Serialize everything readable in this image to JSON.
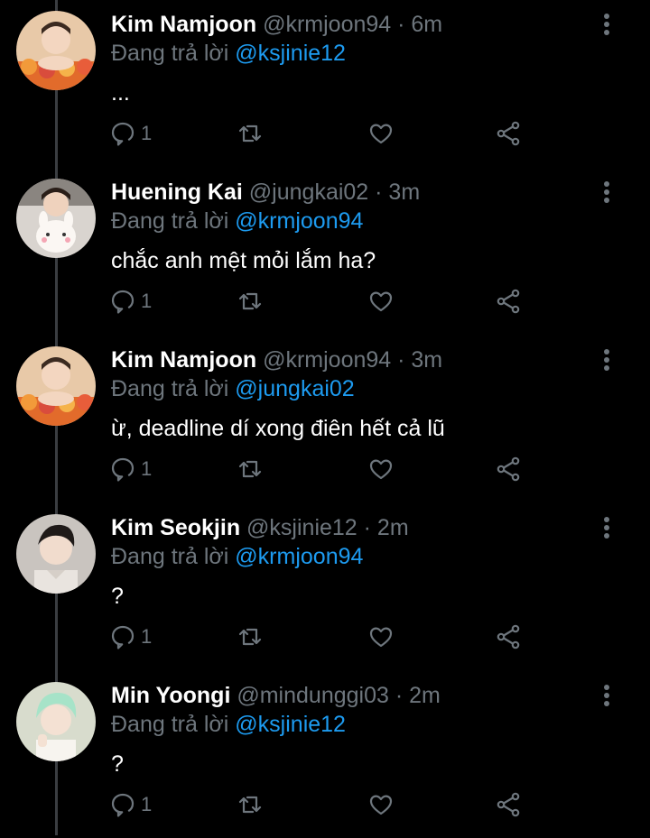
{
  "reply_prefix": "Đang trả lời",
  "tweets": [
    {
      "name": "Kim Namjoon",
      "meta": "@krmjoon94 · 6m",
      "mention": "@ksjinie12",
      "text": "...",
      "reply_count": "1",
      "avatar": "namjoon-flowers"
    },
    {
      "name": "Huening Kai",
      "meta": "@jungkai02 · 3m",
      "mention": "@krmjoon94",
      "text": "chắc anh mệt mỏi lắm ha?",
      "reply_count": "1",
      "avatar": "kai-plush"
    },
    {
      "name": "Kim Namjoon",
      "meta": "@krmjoon94 · 3m",
      "mention": "@jungkai02",
      "text": "ừ, deadline dí xong điên hết cả lũ",
      "reply_count": "1",
      "avatar": "namjoon-flowers"
    },
    {
      "name": "Kim Seokjin",
      "meta": "@ksjinie12 · 2m",
      "mention": "@krmjoon94",
      "text": "?",
      "reply_count": "1",
      "avatar": "seokjin-portrait"
    },
    {
      "name": "Min Yoongi",
      "meta": "@mindunggi03 · 2m",
      "mention": "@ksjinie12",
      "text": "?",
      "reply_count": "1",
      "avatar": "yoongi-mint"
    }
  ],
  "colors": {
    "background": "#000000",
    "secondary_text": "#6e767d",
    "mention": "#1d9bf0",
    "thread_line": "#3a3d41"
  }
}
